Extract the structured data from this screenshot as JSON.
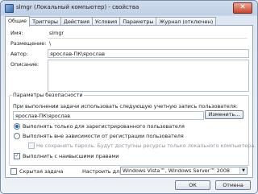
{
  "window": {
    "title": "slmgr (Локальный компьютер) - свойства",
    "close_glyph": "✕"
  },
  "tabs": [
    {
      "label": "Общие",
      "active": true
    },
    {
      "label": "Триггеры",
      "active": false
    },
    {
      "label": "Действия",
      "active": false
    },
    {
      "label": "Условия",
      "active": false
    },
    {
      "label": "Параметры",
      "active": false
    },
    {
      "label": "Журнал (отключен)",
      "active": false
    }
  ],
  "general": {
    "name_label": "Имя:",
    "name_value": "slmgr",
    "location_label": "Размещение:",
    "location_value": "\\",
    "author_label": "Автор:",
    "author_value": "ярослав-ПК\\ярослав",
    "description_label": "Описание:",
    "description_value": ""
  },
  "security": {
    "group_title": "Параметры безопасности",
    "account_prompt": "При выполнении задачи использовать следующую учетную запись пользователя:",
    "account_value": "ярослав-ПК\\ярослав",
    "change_button": "Изменить...",
    "radio_logged_on": "Выполнять только для зарегистрированного пользователя",
    "radio_any": "Выполнять вне зависимости от регистрации пользователя",
    "no_store_password": "Не сохранять пароль. Будут доступны ресурсы только локального компьютера.",
    "highest_privileges": "Выполнить с наивысшими правами",
    "highest_privileges_checked": true,
    "radio_selected": "logged_on"
  },
  "footer": {
    "hidden_task": "Скрытая задача",
    "configure_for_label": "Настроить для:",
    "configure_for_value": "Windows Vista™, Windows Server™ 2008"
  },
  "buttons": {
    "ok": "ОК",
    "cancel": "Отмена"
  }
}
